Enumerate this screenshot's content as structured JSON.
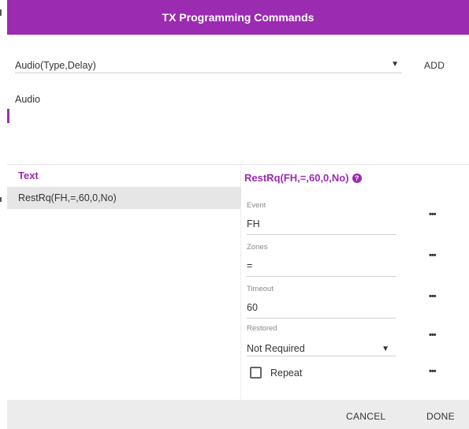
{
  "dialog": {
    "title": "TX Programming Commands",
    "accent_color": "#9b2bb0"
  },
  "command_select": {
    "value": "Audio(Type,Delay)",
    "caret_icon": "dropdown-arrow-icon"
  },
  "add_label": "ADD",
  "description": "Audio",
  "list": {
    "header": "Text",
    "items": [
      {
        "label": "RestRq(FH,=,60,0,No)"
      }
    ]
  },
  "editor": {
    "title": "RestRq(FH,=,60,0,No)",
    "help_icon": "help-icon",
    "fields": {
      "event": {
        "label": "Event",
        "value": "FH"
      },
      "zones": {
        "label": "Zones",
        "value": "="
      },
      "timeout": {
        "label": "Timeout",
        "value": "60"
      },
      "restored": {
        "label": "Restored",
        "value": "Not Required"
      }
    },
    "more_label": "•••",
    "repeat": {
      "label": "Repeat",
      "checked": false
    }
  },
  "footer": {
    "cancel_label": "CANCEL",
    "done_label": "DONE"
  }
}
